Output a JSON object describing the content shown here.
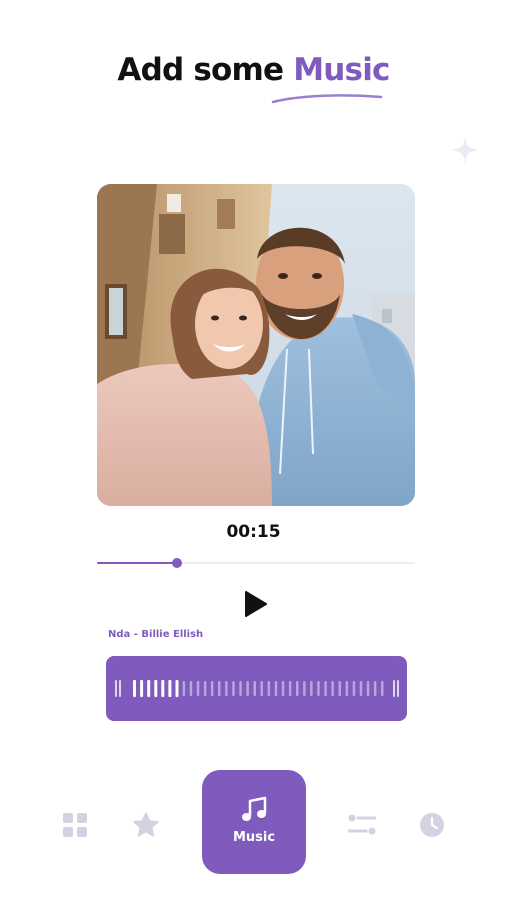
{
  "header": {
    "title_prefix": "Add some ",
    "title_accent": "Music"
  },
  "player": {
    "time": "00:15",
    "progress": 0.25,
    "track_name": "Nda - Billie Ellish"
  },
  "waveform": {
    "bar_count": 36,
    "played_bars": 7
  },
  "nav": {
    "items": [
      {
        "icon": "grid-icon",
        "label": ""
      },
      {
        "icon": "star-icon",
        "label": ""
      },
      {
        "icon": "music-note-icon",
        "label": "Music",
        "active": true
      },
      {
        "icon": "sliders-icon",
        "label": ""
      },
      {
        "icon": "clock-icon",
        "label": ""
      }
    ]
  },
  "colors": {
    "accent": "#7e5bbd",
    "inactive_icon": "#cfc9dc",
    "text": "#111111"
  }
}
